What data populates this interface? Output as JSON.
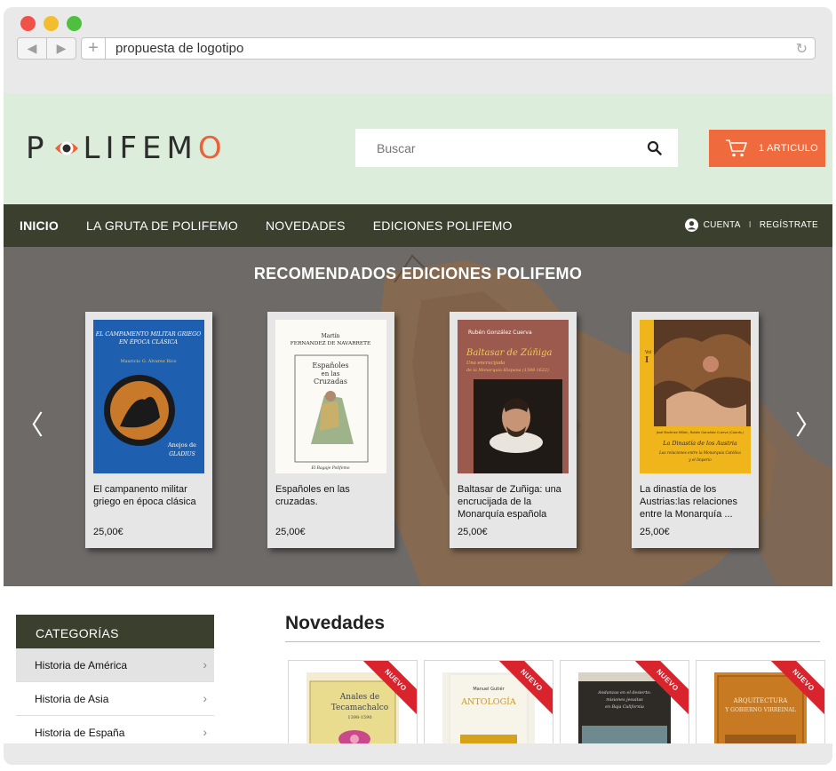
{
  "browser": {
    "url": "propuesta de logotipo"
  },
  "header": {
    "logo_prefix": "P",
    "logo_middle": "LIFEM",
    "logo_suffix": "O",
    "search_placeholder": "Buscar",
    "cart_label": "1 ARTICULO"
  },
  "menu": {
    "items": [
      "INICIO",
      "LA GRUTA DE POLIFEMO",
      "NOVEDADES",
      "EDICIONES POLIFEMO"
    ],
    "account_label": "CUENTA",
    "separator": "I",
    "register_label": "REGÍSTRATE"
  },
  "hero": {
    "title": "RECOMENDADOS  EDICIONES POLIFEMO",
    "books": [
      {
        "title": "El campanento militar griego en época clásica",
        "price": "25,00€",
        "cover_lines": [
          "EL CAMPAMENTO MILITAR GRIEGO",
          "EN ÉPOCA CLÁSICA",
          "Mauricio G. Álvarez Rico",
          "Anejos de",
          "GLADIUS"
        ]
      },
      {
        "title": "Españoles en las cruzadas.",
        "price": "25,00€",
        "cover_lines": [
          "Martín",
          "FERNANDEZ DE NAVARRETE",
          "Españoles",
          "en las",
          "Cruzadas",
          "El Bagaje Polifemo"
        ]
      },
      {
        "title": "Baltasar de Zuñiga: una encrucijada de la Monarquía española",
        "price": "25,00€",
        "cover_lines": [
          "Rubén González Cuerva",
          "Baltasar de Zúñiga",
          "Una encrucijada",
          "de la Monarquía Hispana (1598-1622)"
        ]
      },
      {
        "title": "La dinastía de los Austrias:las relaciones entre la Monarquía ...",
        "price": "25,00€",
        "cover_lines": [
          "Vol",
          "I",
          "José Martínez Millán, Rubén González Cuerva (Coords.)",
          "La Dinastía de los Austria",
          "Las relaciones entre la Monarquía Católica",
          "y el Imperio"
        ]
      }
    ]
  },
  "categories": {
    "heading": "CATEGORÍAS",
    "items": [
      "Historia de América",
      "Historia de Asia",
      "Historia de España"
    ]
  },
  "novedades": {
    "heading": "Novedades",
    "badge": "NUEVO",
    "books": [
      {
        "cover_lines": [
          "Anales de",
          "Tecamachalco",
          "1398-1590"
        ]
      },
      {
        "cover_lines": [
          "Manuel Gutiér",
          "ANTOLOGÍA"
        ]
      },
      {
        "cover_lines": [
          "Andanzas en el desierto:",
          "misiones jesuitas",
          "en Baja California"
        ]
      },
      {
        "cover_lines": [
          "ARQUITECTURA",
          "Y GOBIERNO VIRREINAL"
        ]
      }
    ]
  },
  "colors": {
    "header_bg": "#ddeddb",
    "menu_bg": "#3a3f2e",
    "accent": "#ef6a3d",
    "ribbon": "#d9232d"
  }
}
